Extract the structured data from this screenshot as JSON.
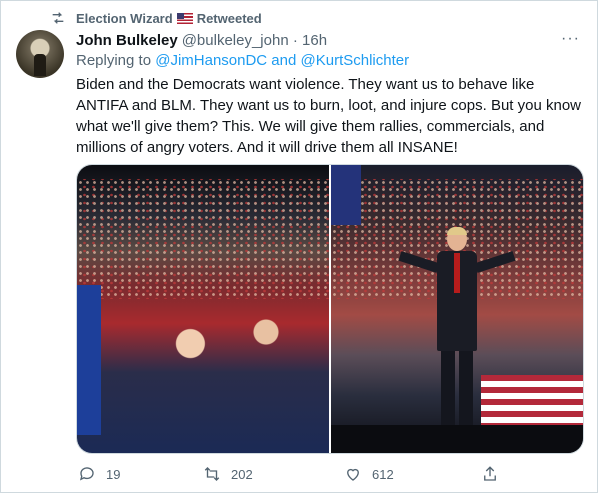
{
  "retweet_context": {
    "retweeter": "Election Wizard",
    "retweeted_label": "Retweeted"
  },
  "author": {
    "name": "John Bulkeley",
    "handle": "@bulkeley_john",
    "separator": " · ",
    "time": "16h"
  },
  "reply": {
    "prefix": "Replying to ",
    "mention_1": "@JimHansonDC",
    "conjunction": " and ",
    "mention_2": "@KurtSchlichter"
  },
  "tweet": {
    "text": "Biden and the Democrats want violence. They want us to behave like ANTIFA and BLM. They want us to burn, loot, and injure cops. But you know what we'll give them? This. We will give them rallies, commercials, and millions of angry voters. And it will drive them all INSANE!"
  },
  "more_label": "···",
  "actions": {
    "replies": "19",
    "retweets": "202",
    "likes": "612"
  },
  "icons": {
    "retweet_context": "retweet-icon",
    "flag": "us-flag-icon",
    "more": "more-icon",
    "reply": "reply-icon",
    "retweet": "retweet-icon",
    "like": "heart-icon",
    "share": "share-icon"
  },
  "colors": {
    "link": "#1d9bf0",
    "secondary_text": "#536471",
    "primary_text": "#0f1419",
    "border": "#cfd9de"
  }
}
